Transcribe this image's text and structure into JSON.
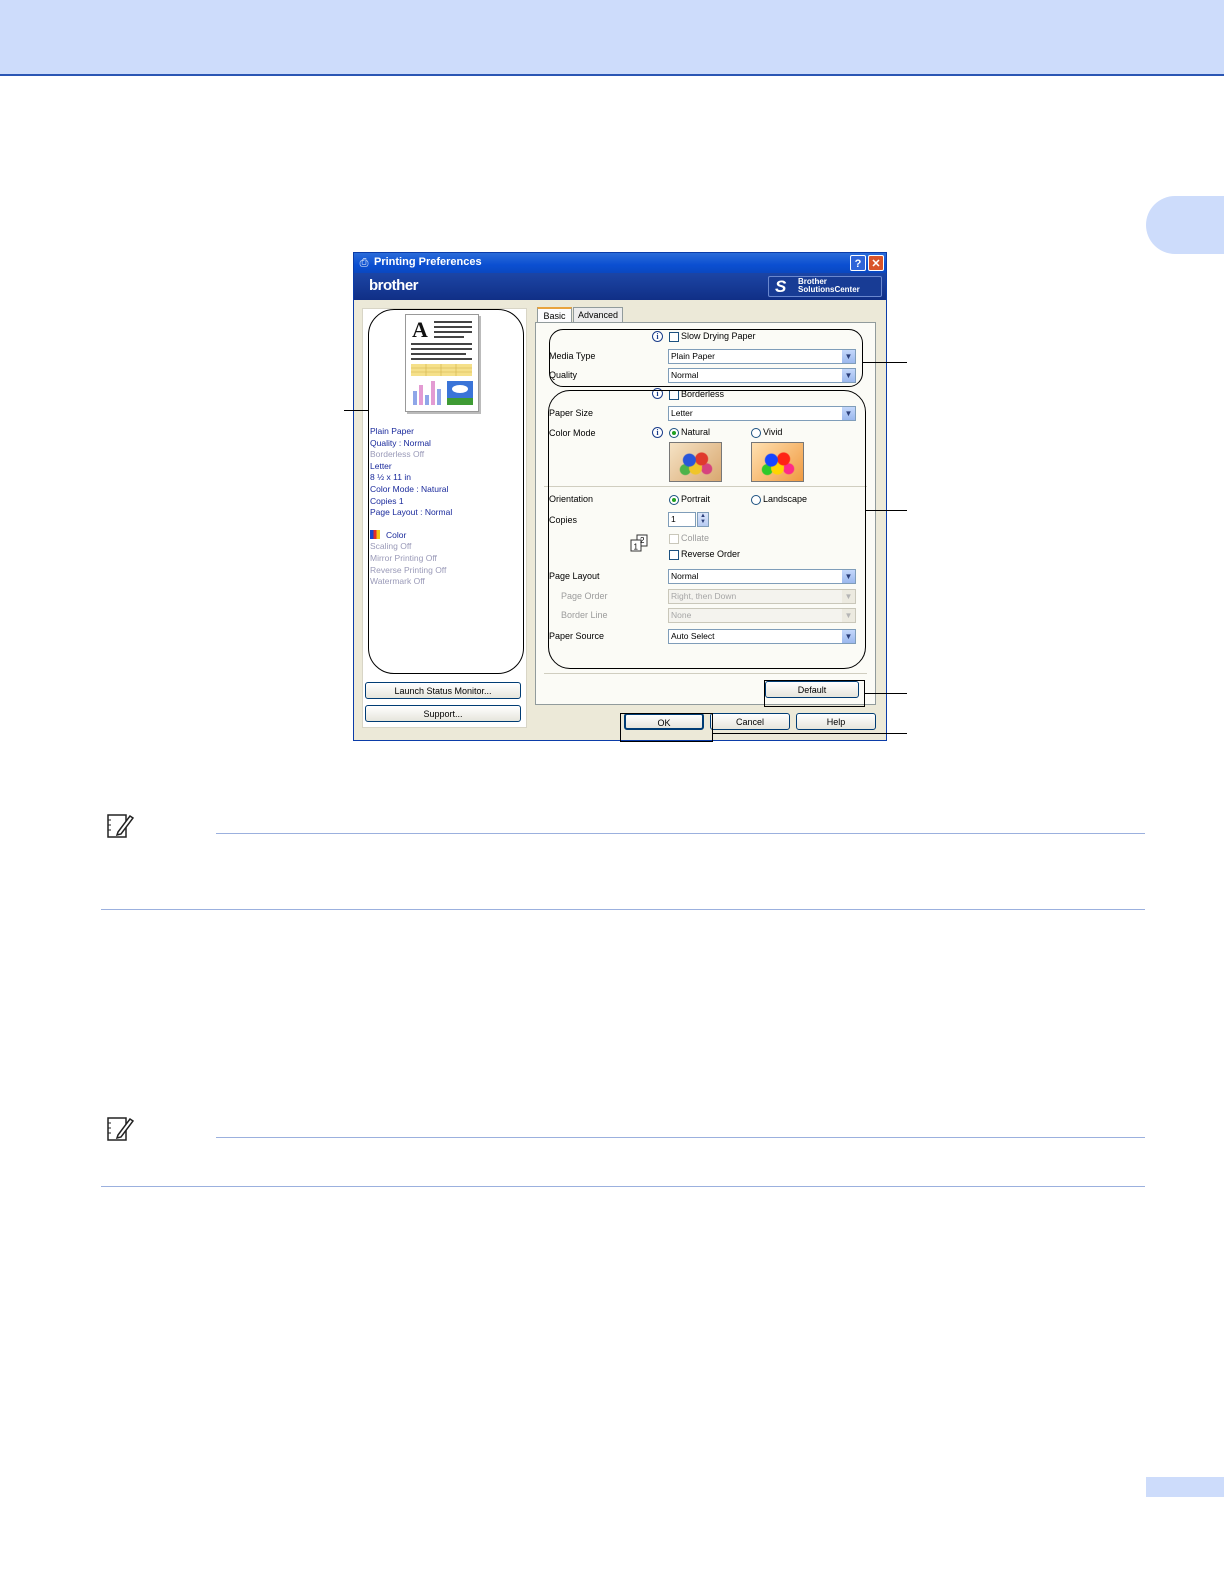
{
  "dialog": {
    "title": "Printing Preferences",
    "brand": "brother",
    "solutions_line1": "Brother",
    "solutions_line2": "SolutionsCenter",
    "help_glyph": "?",
    "close_glyph": "✕"
  },
  "preview_info": {
    "media": "Plain Paper",
    "quality": "Quality : Normal",
    "borderless": "Borderless Off",
    "paper": "Letter",
    "size": "8 ½ x 11 in",
    "color_mode": "Color Mode : Natural",
    "copies": "Copies 1",
    "page_layout": "Page Layout : Normal",
    "color": "Color",
    "scaling": "Scaling Off",
    "mirror": "Mirror Printing Off",
    "reverse": "Reverse Printing Off",
    "watermark": "Watermark Off"
  },
  "buttons": {
    "launch": "Launch Status Monitor...",
    "support": "Support...",
    "default": "Default",
    "ok": "OK",
    "cancel": "Cancel",
    "help": "Help"
  },
  "tabs": [
    "Basic",
    "Advanced"
  ],
  "settings": {
    "slow_drying": "Slow Drying Paper",
    "media_type_label": "Media Type",
    "media_type_value": "Plain Paper",
    "quality_label": "Quality",
    "quality_value": "Normal",
    "borderless": "Borderless",
    "paper_size_label": "Paper Size",
    "paper_size_value": "Letter",
    "color_mode_label": "Color Mode",
    "natural": "Natural",
    "vivid": "Vivid",
    "orientation_label": "Orientation",
    "portrait": "Portrait",
    "landscape": "Landscape",
    "copies_label": "Copies",
    "copies_value": "1",
    "collate": "Collate",
    "reverse_order": "Reverse Order",
    "page_layout_label": "Page Layout",
    "page_layout_value": "Normal",
    "page_order_label": "Page Order",
    "page_order_value": "Right, then Down",
    "border_line_label": "Border Line",
    "border_line_value": "None",
    "paper_source_label": "Paper Source",
    "paper_source_value": "Auto Select",
    "info_glyph": "i"
  },
  "colors": {
    "header_band": "#cddcfb",
    "header_rule": "#2a56b4",
    "note_rule": "#9bb0de"
  },
  "icons": [
    "printer-icon",
    "help-icon",
    "close-icon",
    "info-icon",
    "note-icon",
    "color-icon",
    "collate-icon"
  ]
}
